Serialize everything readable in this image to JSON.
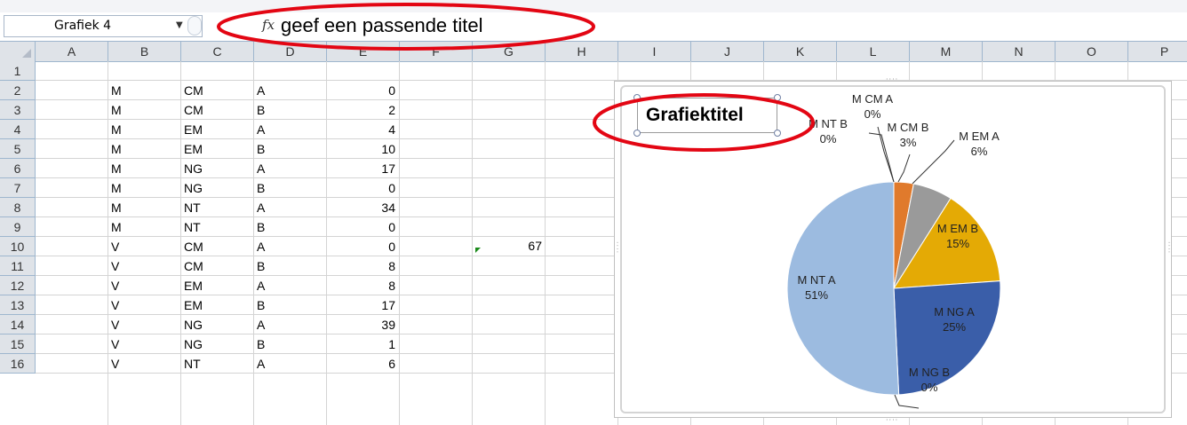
{
  "namebox": {
    "value": "Grafiek 4"
  },
  "formula": {
    "fx_label": "fx",
    "text": "geef een passende titel"
  },
  "columns": [
    "A",
    "B",
    "C",
    "D",
    "E",
    "F",
    "G",
    "H",
    "I",
    "J",
    "K",
    "L",
    "M",
    "N",
    "O",
    "P"
  ],
  "rows": [
    {
      "num": "1",
      "b": "",
      "c": "",
      "d": "",
      "e": ""
    },
    {
      "num": "2",
      "b": "M",
      "c": "CM",
      "d": "A",
      "e": "0"
    },
    {
      "num": "3",
      "b": "M",
      "c": "CM",
      "d": "B",
      "e": "2"
    },
    {
      "num": "4",
      "b": "M",
      "c": "EM",
      "d": "A",
      "e": "4"
    },
    {
      "num": "5",
      "b": "M",
      "c": "EM",
      "d": "B",
      "e": "10"
    },
    {
      "num": "6",
      "b": "M",
      "c": "NG",
      "d": "A",
      "e": "17"
    },
    {
      "num": "7",
      "b": "M",
      "c": "NG",
      "d": "B",
      "e": "0"
    },
    {
      "num": "8",
      "b": "M",
      "c": "NT",
      "d": "A",
      "e": "34"
    },
    {
      "num": "9",
      "b": "M",
      "c": "NT",
      "d": "B",
      "e": "0"
    },
    {
      "num": "10",
      "b": "V",
      "c": "CM",
      "d": "A",
      "e": "0"
    },
    {
      "num": "11",
      "b": "V",
      "c": "CM",
      "d": "B",
      "e": "8"
    },
    {
      "num": "12",
      "b": "V",
      "c": "EM",
      "d": "A",
      "e": "8"
    },
    {
      "num": "13",
      "b": "V",
      "c": "EM",
      "d": "B",
      "e": "17"
    },
    {
      "num": "14",
      "b": "V",
      "c": "NG",
      "d": "A",
      "e": "39"
    },
    {
      "num": "15",
      "b": "V",
      "c": "NG",
      "d": "B",
      "e": "1"
    },
    {
      "num": "16",
      "b": "V",
      "c": "NT",
      "d": "A",
      "e": "6"
    }
  ],
  "g9": "67",
  "chart": {
    "title": "Grafiektitel",
    "slices": [
      {
        "label": "M CM A",
        "pct": "0%",
        "value": 0,
        "color": "#4f81bd"
      },
      {
        "label": "M CM B",
        "pct": "3%",
        "value": 2,
        "color": "#e07a2c"
      },
      {
        "label": "M EM A",
        "pct": "6%",
        "value": 4,
        "color": "#9a9a9a"
      },
      {
        "label": "M EM B",
        "pct": "15%",
        "value": 10,
        "color": "#e4aa05"
      },
      {
        "label": "M NG A",
        "pct": "25%",
        "value": 17,
        "color": "#3a5ea9"
      },
      {
        "label": "M NG B",
        "pct": "0%",
        "value": 0,
        "color": "#7aa447"
      },
      {
        "label": "M NT A",
        "pct": "51%",
        "value": 34,
        "color": "#9cbbe0"
      },
      {
        "label": "M NT B",
        "pct": "0%",
        "value": 0,
        "color": "#254a87"
      }
    ]
  },
  "chart_data": {
    "type": "pie",
    "title": "Grafiektitel",
    "categories": [
      "M CM A",
      "M CM B",
      "M EM A",
      "M EM B",
      "M NG A",
      "M NG B",
      "M NT A",
      "M NT B"
    ],
    "values": [
      0,
      2,
      4,
      10,
      17,
      0,
      34,
      0
    ],
    "percent_labels": [
      "0%",
      "3%",
      "6%",
      "15%",
      "25%",
      "0%",
      "51%",
      "0%"
    ],
    "legend": "none"
  },
  "colors": {
    "header_bg": "#dfe3e8",
    "annotation": "#e30613",
    "grid": "#d4d4d4"
  }
}
